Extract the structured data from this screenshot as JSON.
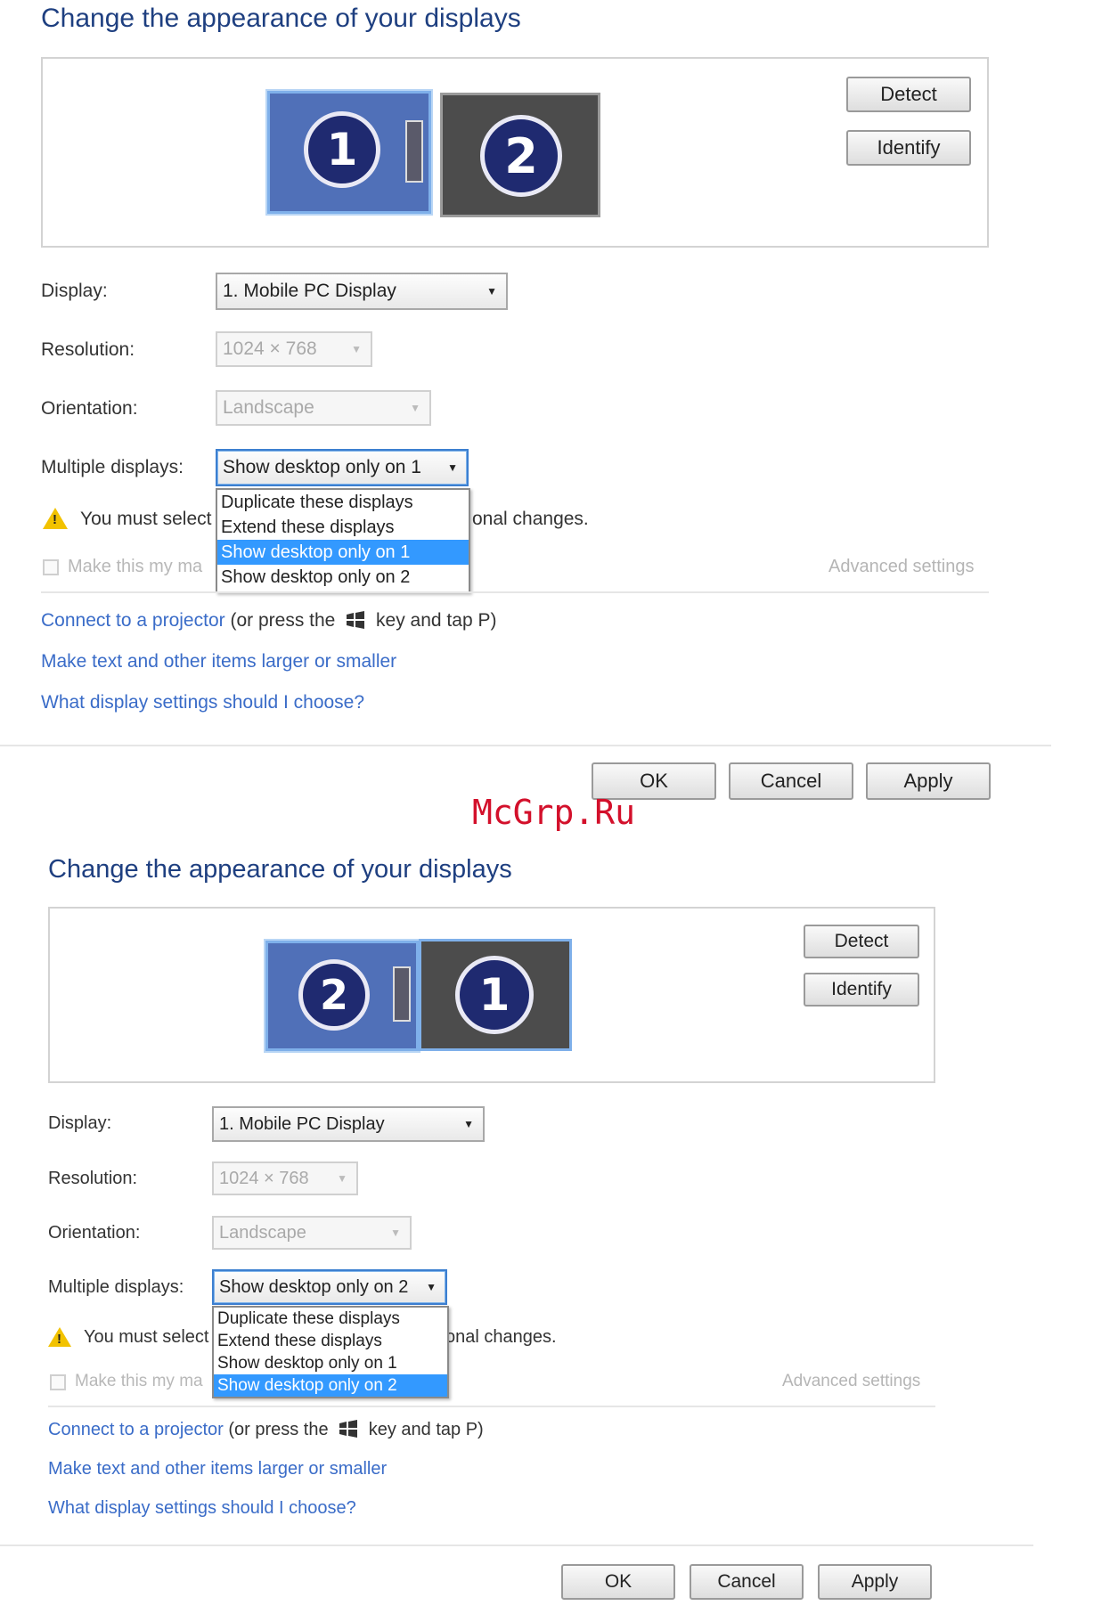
{
  "panels": [
    {
      "title": "Change the appearance of your displays",
      "monitors": [
        {
          "number": "1",
          "state": "active"
        },
        {
          "number": "2",
          "state": "inactive"
        }
      ],
      "detect_label": "Detect",
      "identify_label": "Identify",
      "display_label": "Display:",
      "display_value": "1. Mobile PC Display",
      "resolution_label": "Resolution:",
      "resolution_value": "1024 × 768",
      "orientation_label": "Orientation:",
      "orientation_value": "Landscape",
      "multiple_label": "Multiple displays:",
      "multiple_value": "Show desktop only on 1",
      "dropdown_options": [
        "Duplicate these displays",
        "Extend these displays",
        "Show desktop only on 1",
        "Show desktop only on 2"
      ],
      "dropdown_selected": "Show desktop only on 1",
      "warning_left": "You must select",
      "warning_right": "onal changes.",
      "checkbox_label": "Make this my ma",
      "advanced_label": "Advanced settings",
      "link_projector": "Connect to a projector",
      "link_projector_rest_a": "(or press the",
      "link_projector_rest_b": "key and tap P)",
      "link_text_size": "Make text and other items larger or smaller",
      "link_help": "What display settings should I choose?",
      "ok_label": "OK",
      "cancel_label": "Cancel",
      "apply_label": "Apply"
    },
    {
      "title": "Change the appearance of your displays",
      "monitors": [
        {
          "number": "2",
          "state": "active"
        },
        {
          "number": "1",
          "state": "inactive"
        }
      ],
      "detect_label": "Detect",
      "identify_label": "Identify",
      "display_label": "Display:",
      "display_value": "1. Mobile PC Display",
      "resolution_label": "Resolution:",
      "resolution_value": "1024 × 768",
      "orientation_label": "Orientation:",
      "orientation_value": "Landscape",
      "multiple_label": "Multiple displays:",
      "multiple_value": "Show desktop only on 2",
      "dropdown_options": [
        "Duplicate these displays",
        "Extend these displays",
        "Show desktop only on 1",
        "Show desktop only on 2"
      ],
      "dropdown_selected": "Show desktop only on 2",
      "warning_left": "You must select",
      "warning_right": "onal changes.",
      "checkbox_label": "Make this my ma",
      "advanced_label": "Advanced settings",
      "link_projector": "Connect to a projector",
      "link_projector_rest_a": "(or press the",
      "link_projector_rest_b": "key and tap P)",
      "link_text_size": "Make text and other items larger or smaller",
      "link_help": "What display settings should I choose?",
      "ok_label": "OK",
      "cancel_label": "Cancel",
      "apply_label": "Apply"
    }
  ],
  "watermark": "McGrp.Ru",
  "icons": {
    "warning": "warning-icon",
    "windows_key": "windows-logo-icon",
    "dropdown_arrow": "chevron-down-icon"
  },
  "colors": {
    "title": "#1e3f80",
    "link": "#3a6cc8",
    "selection": "#3399ff",
    "watermark": "#d3102b",
    "active_monitor": "#5070b8",
    "inactive_monitor": "#4c4c4c"
  }
}
